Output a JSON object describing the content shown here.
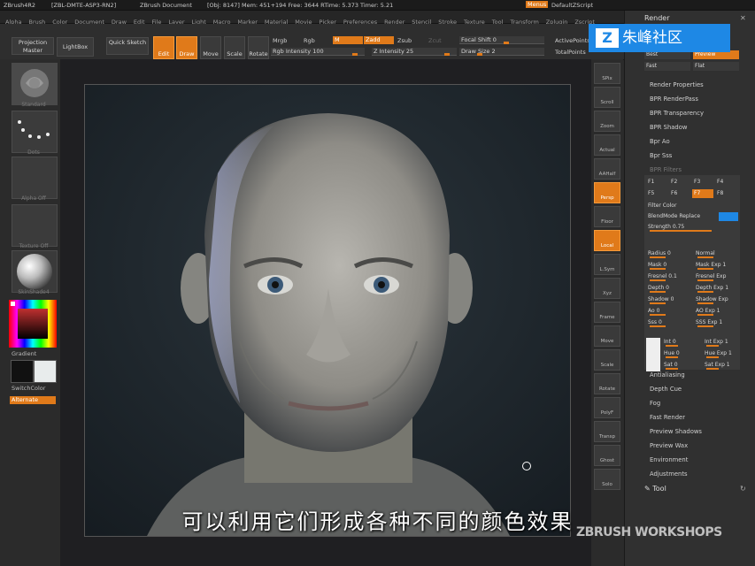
{
  "titlebar": {
    "app": "ZBrush4R2",
    "project": "[ZBL-DMTE-ASP3-RN2]",
    "document": "ZBrush Document",
    "stats": "[Obj: 8147]  Mem: 451+194  Free: 3644  RTime: 5.373  Timer: 5.21",
    "menus_label": "Menus",
    "script_label": "DefaultZScript"
  },
  "menubar": [
    "Alpha",
    "Brush",
    "Color",
    "Document",
    "Draw",
    "Edit",
    "File",
    "Layer",
    "Light",
    "Macro",
    "Marker",
    "Material",
    "Movie",
    "Picker",
    "Preferences",
    "Render",
    "Stencil",
    "Stroke",
    "Texture",
    "Tool",
    "Transform",
    "Zplugin",
    "Zscript"
  ],
  "shelf": {
    "projection": "Projection Master",
    "lightbox": "LightBox",
    "quicksketch": "Quick Sketch",
    "edit": "Edit",
    "draw": "Draw",
    "move": "Move",
    "scale": "Scale",
    "rotate": "Rotate",
    "mrgb": "Mrgb",
    "rgb": "Rgb",
    "m": "M",
    "zadd": "Zadd",
    "zsub": "Zsub",
    "zcut": "Zcut",
    "rgb_intensity": "Rgb Intensity 100",
    "z_intensity": "Z Intensity 25",
    "focal_shift": "Focal Shift 0",
    "draw_size": "Draw Size 2",
    "active_points": "ActivePoints",
    "total_points": "TotalPoints"
  },
  "left_tray": {
    "brush": "Standard",
    "stroke": "Dots",
    "alpha": "Alpha Off",
    "texture": "Texture Off",
    "material": "SkinShade4",
    "gradient": "Gradient",
    "switch_color": "SwitchColor",
    "alternate": "Alternate"
  },
  "right_tools": [
    "SPix",
    "Scroll",
    "Zoom",
    "Actual",
    "AAHalf",
    "Persp",
    "Floor",
    "Local",
    "L.Sym",
    "Xyz",
    "Frame",
    "Move",
    "Scale",
    "Rotate",
    "PolyF",
    "Transp",
    "Ghost",
    "Solo"
  ],
  "palette": {
    "title": "Render",
    "best": "Best",
    "preview": "Preview",
    "fast": "Fast",
    "flat": "Flat",
    "items_top": [
      "Render Properties",
      "BPR RenderPass",
      "BPR Transparency",
      "BPR Shadow",
      "Bpr Ao",
      "Bpr Sss",
      "BPR Filters"
    ],
    "filters": [
      "F1",
      "F2",
      "F3",
      "F4",
      "F5",
      "F6",
      "F7",
      "F8"
    ],
    "filter_color": "Filter Color",
    "blend": "BlendMode Replace",
    "strength": "Strength 0.75",
    "radius": "Radius 0",
    "normal": "Normal",
    "mask": "Mask 0",
    "mask_exp": "Mask Exp 1",
    "fresnel": "Fresnel 0.1",
    "fresnel_exp": "Fresnel Exp",
    "depth": "Depth 0",
    "depth_exp": "Depth Exp 1",
    "shadow": "Shadow 0",
    "shadow_exp": "Shadow Exp",
    "ao": "Ao 0",
    "ao_exp": "AO Exp 1",
    "sss": "Sss 0",
    "sss_exp": "SSS Exp 1",
    "int": "Int 0",
    "int_exp": "Int Exp 1",
    "hue": "Hue 0",
    "hue_exp": "Hue Exp 1",
    "sat": "Sat 0",
    "sat_exp": "Sat Exp 1",
    "items_bottom": [
      "Antialiasing",
      "Depth Cue",
      "Fog",
      "Fast Render",
      "Preview Shadows",
      "Preview Wax",
      "Environment",
      "Adjustments"
    ],
    "tool": "Tool"
  },
  "subtitle": "可以利用它们形成各种不同的颜色效果",
  "watermark": "ZBRUSH WORKSHOPS",
  "logo": "朱峰社区"
}
